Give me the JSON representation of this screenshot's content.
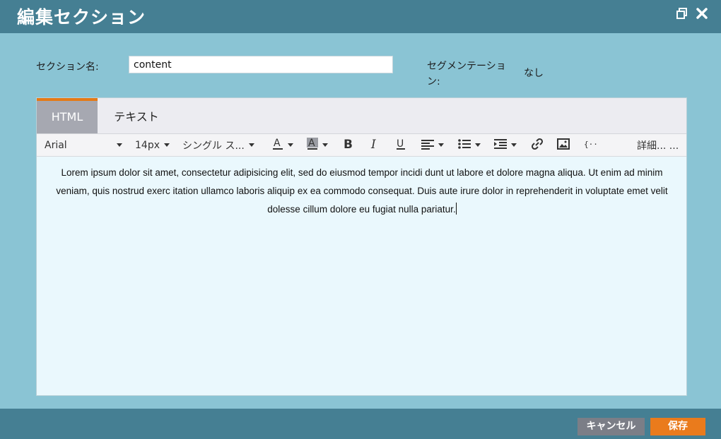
{
  "window": {
    "title": "編集セクション",
    "icons": [
      "restore-icon",
      "close-icon"
    ]
  },
  "form": {
    "section_name_label": "セクション名:",
    "section_name_value": "content",
    "segmentation_label": "セグメンテーション:",
    "segmentation_value": "なし"
  },
  "editor": {
    "tabs": [
      {
        "label": "HTML",
        "active": true
      },
      {
        "label": "テキスト",
        "active": false
      }
    ],
    "toolbar": {
      "font_family": "Arial",
      "font_size": "14px",
      "style": "シングル ス...",
      "more": "詳細... ...",
      "icons": [
        "text-color-icon",
        "highlight-color-icon",
        "bold-icon",
        "italic-icon",
        "underline-icon",
        "align-icon",
        "list-icon",
        "indent-icon",
        "link-icon",
        "image-icon",
        "token-icon"
      ]
    },
    "body_text": "Lorem ipsum dolor sit amet, consectetur adipisicing elit, sed do eiusmod tempor incidi dunt ut labore et dolore magna aliqua. Ut enim ad minim veniam, quis nostrud exerc itation ullamco laboris aliquip ex ea commodo consequat. Duis aute irure dolor in reprehenderit in voluptate emet velit dolesse cillum dolore eu fugiat nulla pariatur."
  },
  "footer": {
    "cancel_label": "キャンセル",
    "save_label": "保存"
  },
  "colors": {
    "header": "#457f93",
    "background": "#8ac4d4",
    "accent": "#ea7b1c",
    "editor_bg": "#eaf8fd"
  }
}
